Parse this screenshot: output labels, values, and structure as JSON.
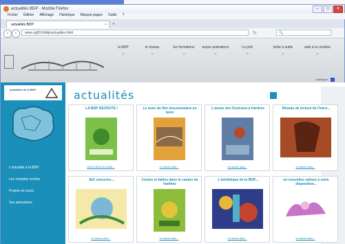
{
  "window": {
    "title": "actualités BDP - Mozilla Firefox"
  },
  "menu": [
    "Fichier",
    "Édition",
    "Affichage",
    "Historique",
    "Marque-pages",
    "Outils",
    "?"
  ],
  "tab": {
    "title": "actualités BDP"
  },
  "url": "www.cg60.fr/bdp/actualites.html",
  "nav_items": [
    "la BDP",
    "le réseau",
    "les formations",
    "expos animations",
    "Le prêt",
    "boîte à outils",
    "aide à la création"
  ],
  "header_mini_link": "catalogue",
  "sidebar": {
    "logo_text": "actualités de la BDP",
    "links": [
      "L'actualité à la BDP",
      "Les comptes rendus",
      "Projets en cours",
      "Vos animations"
    ]
  },
  "page_heading": "actualités",
  "cards": [
    {
      "title": "LA BDP RECRUTE !",
      "more": "Voir la fiche de poste..."
    },
    {
      "title": "Le mois du film documentaire en Isère",
      "more": "en savoir plus..."
    },
    {
      "title": "L'année des Pyrénées à Hardres",
      "more": "en savoir plus..."
    },
    {
      "title": "Réseau de lecture de l'Isère...",
      "more": "en savoir plus..."
    },
    {
      "title": "Bd! concerne...",
      "more": "en savoir plus..."
    },
    {
      "title": "Contes et fables dans le canton de Varilhes",
      "more": "en savoir plus..."
    },
    {
      "title": "L'artothèque de la BDP...",
      "more": "en savoir plus..."
    },
    {
      "title": "un nouvelles valises à votre disposition...",
      "more": "en savoir plus..."
    }
  ]
}
